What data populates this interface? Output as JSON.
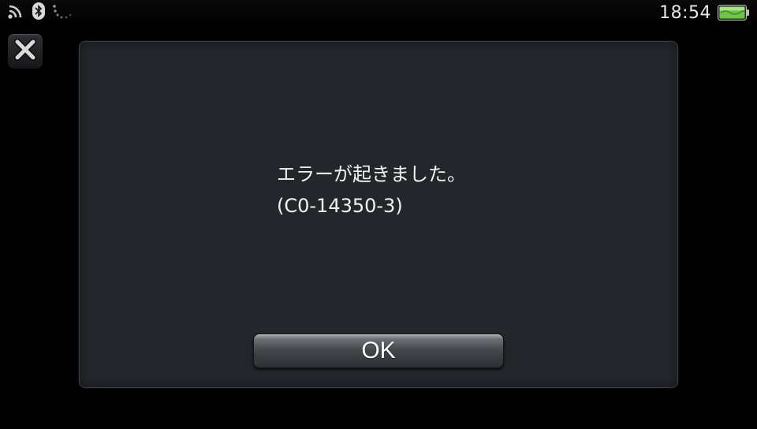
{
  "status_bar": {
    "time": "18:54",
    "icons": [
      "wifi-icon",
      "bluetooth-icon",
      "loading-spinner-icon",
      "battery-icon"
    ],
    "battery_color": "#6fc24a"
  },
  "close_button": {
    "icon": "close-icon"
  },
  "dialog": {
    "message_line1": "エラーが起きました。",
    "message_line2": "(C0-14350-3)",
    "ok_label": "OK",
    "background": "#23262b"
  }
}
